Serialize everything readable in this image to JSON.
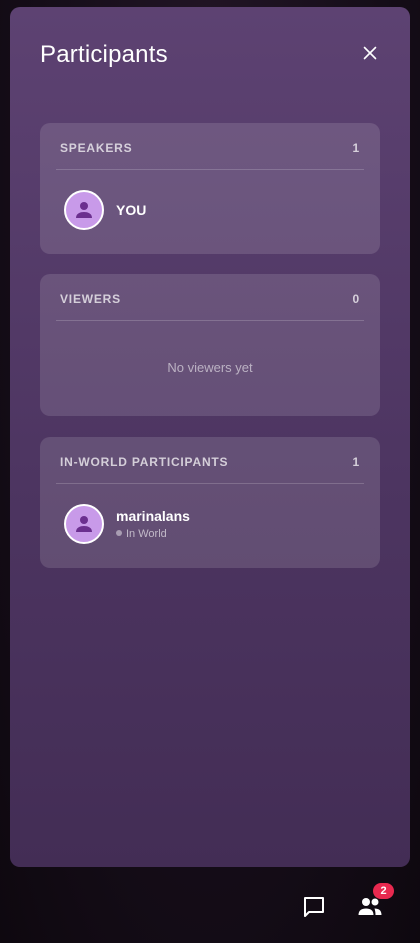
{
  "panel": {
    "title": "Participants"
  },
  "sections": {
    "speakers": {
      "header": "SPEAKERS",
      "count": "1",
      "participants": [
        {
          "name": "YOU"
        }
      ]
    },
    "viewers": {
      "header": "VIEWERS",
      "count": "0",
      "empty_text": "No viewers yet"
    },
    "in_world": {
      "header": "IN-WORLD PARTICIPANTS",
      "count": "1",
      "participants": [
        {
          "name": "marinalans",
          "status": "In World"
        }
      ]
    }
  },
  "bottom_bar": {
    "participants_badge": "2",
    "icons": [
      "chat-icon",
      "participants-icon"
    ]
  },
  "colors": {
    "panel_top": "#5d4272",
    "panel_bottom": "#432d55",
    "avatar_fill": "#c89ae9",
    "avatar_glyph": "#6b2f8f",
    "badge": "#e8294f"
  }
}
